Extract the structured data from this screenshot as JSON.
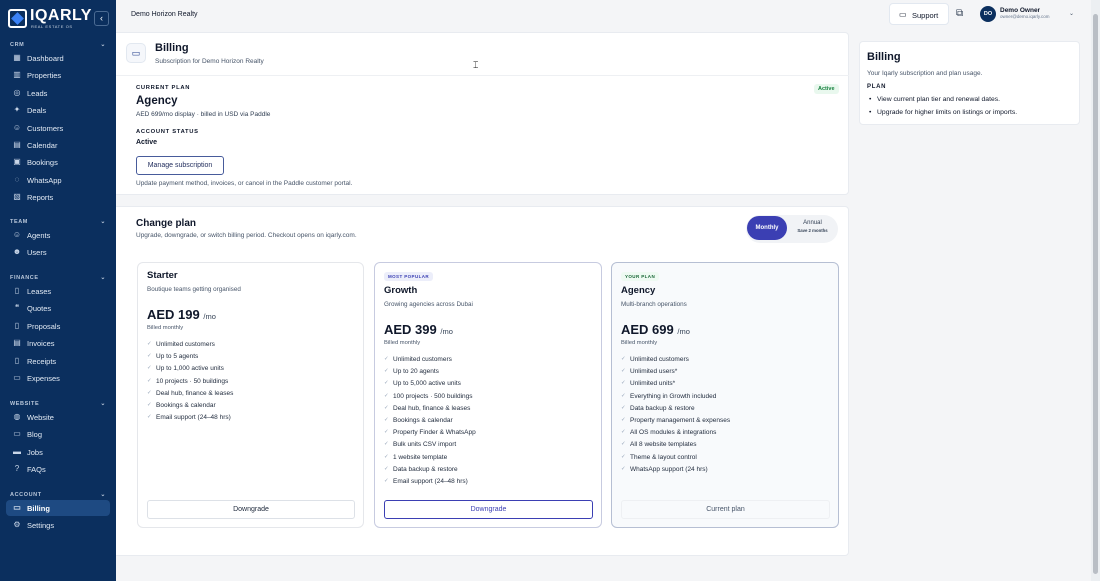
{
  "brand": {
    "name": "IQARLY",
    "tagline": "REAL ESTATE OS"
  },
  "sidebar": {
    "sections": [
      {
        "title": "CRM",
        "items": [
          {
            "label": "Dashboard",
            "icon": "grid-icon"
          },
          {
            "label": "Properties",
            "icon": "building-icon"
          },
          {
            "label": "Leads",
            "icon": "target-icon"
          },
          {
            "label": "Deals",
            "icon": "handshake-icon"
          },
          {
            "label": "Customers",
            "icon": "user-icon"
          },
          {
            "label": "Calendar",
            "icon": "calendar-icon"
          },
          {
            "label": "Bookings",
            "icon": "calendar-check-icon"
          },
          {
            "label": "WhatsApp",
            "icon": "chat-icon"
          },
          {
            "label": "Reports",
            "icon": "chart-icon"
          }
        ]
      },
      {
        "title": "TEAM",
        "items": [
          {
            "label": "Agents",
            "icon": "user-badge-icon"
          },
          {
            "label": "Users",
            "icon": "users-icon"
          }
        ]
      },
      {
        "title": "FINANCE",
        "items": [
          {
            "label": "Leases",
            "icon": "document-icon"
          },
          {
            "label": "Quotes",
            "icon": "quote-icon"
          },
          {
            "label": "Proposals",
            "icon": "file-icon"
          },
          {
            "label": "Invoices",
            "icon": "invoice-icon"
          },
          {
            "label": "Receipts",
            "icon": "receipt-icon"
          },
          {
            "label": "Expenses",
            "icon": "wallet-icon"
          }
        ]
      },
      {
        "title": "WEBSITE",
        "items": [
          {
            "label": "Website",
            "icon": "globe-icon"
          },
          {
            "label": "Blog",
            "icon": "book-icon"
          },
          {
            "label": "Jobs",
            "icon": "briefcase-icon"
          },
          {
            "label": "FAQs",
            "icon": "help-icon"
          }
        ]
      },
      {
        "title": "ACCOUNT",
        "items": [
          {
            "label": "Billing",
            "icon": "credit-card-icon",
            "active": true
          },
          {
            "label": "Settings",
            "icon": "gear-icon"
          }
        ]
      }
    ]
  },
  "topbar": {
    "workspace": "Demo Horizon Realty",
    "support_label": "Support",
    "user": {
      "initials": "DO",
      "name": "Demo Owner",
      "email": "owner@demo.iqarly.com"
    }
  },
  "page": {
    "title": "Billing",
    "subtitle": "Subscription for Demo Horizon Realty"
  },
  "current_plan": {
    "caption": "CURRENT PLAN",
    "name": "Agency",
    "price_line": "AED 699/mo display · billed in USD via Paddle",
    "status_badge": "Active",
    "account_status_caption": "ACCOUNT STATUS",
    "account_status": "Active",
    "manage_button": "Manage subscription",
    "manage_note": "Update payment method, invoices, or cancel in the Paddle customer portal."
  },
  "change_plan": {
    "title": "Change plan",
    "subtitle": "Upgrade, downgrade, or switch billing period. Checkout opens on iqarly.com.",
    "toggle": {
      "monthly": "Monthly",
      "annual": "Annual",
      "annual_note": "Save 2 months",
      "selected": "Monthly"
    }
  },
  "plans": [
    {
      "badge": "",
      "name": "Starter",
      "description": "Boutique teams getting organised",
      "price": "AED 199",
      "per": "/mo",
      "billed": "Billed monthly",
      "features": [
        "Unlimited customers",
        "Up to 5 agents",
        "Up to 1,000 active units",
        "10 projects · 50 buildings",
        "Deal hub, finance & leases",
        "Bookings & calendar",
        "Email support (24–48 hrs)"
      ],
      "button": "Downgrade"
    },
    {
      "badge": "MOST POPULAR",
      "name": "Growth",
      "description": "Growing agencies across Dubai",
      "price": "AED 399",
      "per": "/mo",
      "billed": "Billed monthly",
      "features": [
        "Unlimited customers",
        "Up to 20 agents",
        "Up to 5,000 active units",
        "100 projects · 500 buildings",
        "Deal hub, finance & leases",
        "Bookings & calendar",
        "Property Finder & WhatsApp",
        "Bulk units CSV import",
        "1 website template",
        "Data backup & restore",
        "Email support (24–48 hrs)"
      ],
      "button": "Downgrade"
    },
    {
      "badge": "YOUR PLAN",
      "name": "Agency",
      "description": "Multi-branch operations",
      "price": "AED 699",
      "per": "/mo",
      "billed": "Billed monthly",
      "features": [
        "Unlimited customers",
        "Unlimited users*",
        "Unlimited units*",
        "Everything in Growth included",
        "Data backup & restore",
        "Property management & expenses",
        "All OS modules & integrations",
        "All 8 website templates",
        "Theme & layout control",
        "WhatsApp support (24 hrs)"
      ],
      "button": "Current plan"
    }
  ],
  "right_panel": {
    "title": "Billing",
    "description": "Your Iqarly subscription and plan usage.",
    "caption": "PLAN",
    "bullets": [
      "View current plan tier and renewal dates.",
      "Upgrade for higher limits on listings or imports."
    ]
  }
}
